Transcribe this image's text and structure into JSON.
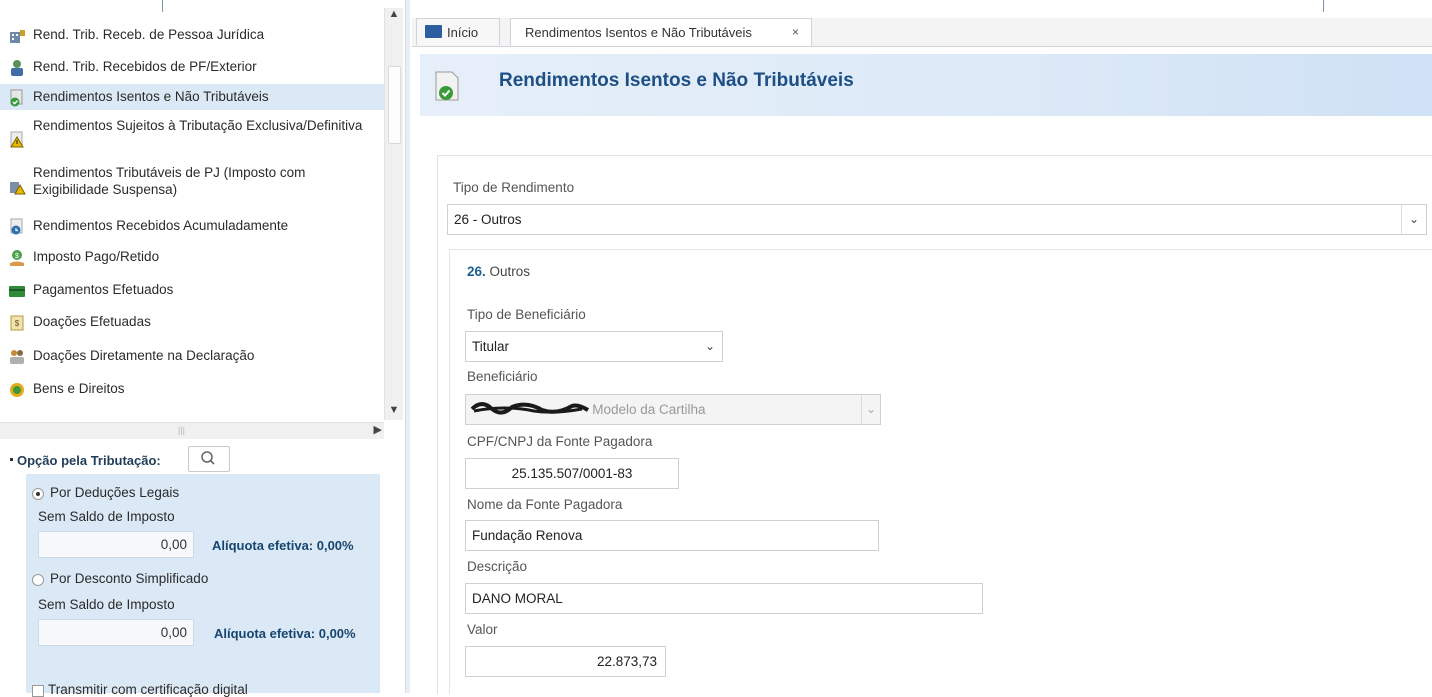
{
  "nav": {
    "items": [
      {
        "label": "Rend. Trib. Receb. de Pessoa Jurídica",
        "icon": "building-tax-icon"
      },
      {
        "label": "Rend. Trib. Recebidos de PF/Exterior",
        "icon": "person-money-icon"
      },
      {
        "label": "Rendimentos Isentos e Não Tributáveis",
        "icon": "document-check-icon",
        "selected": true
      },
      {
        "label": "Rendimentos Sujeitos à Tributação Exclusiva/Definitiva",
        "icon": "warning-document-icon"
      },
      {
        "label": "Rendimentos Tributáveis de PJ (Imposto com Exigibilidade Suspensa)",
        "icon": "building-warning-icon"
      },
      {
        "label": "Rendimentos Recebidos Acumuladamente",
        "icon": "document-clock-icon"
      },
      {
        "label": "Imposto Pago/Retido",
        "icon": "money-hand-icon"
      },
      {
        "label": "Pagamentos Efetuados",
        "icon": "card-icon"
      },
      {
        "label": "Doações Efetuadas",
        "icon": "donation-note-icon"
      },
      {
        "label": "Doações Diretamente na Declaração",
        "icon": "people-donation-icon"
      },
      {
        "label": "Bens e Direitos",
        "icon": "assets-icon"
      }
    ]
  },
  "tributacao": {
    "title": "Opção pela Tributação:",
    "deducoes": {
      "label": "Por Deduções Legais",
      "saldo": "Sem Saldo de Imposto",
      "valor": "0,00",
      "aliquota": "Alíquota efetiva: 0,00%",
      "selected": true
    },
    "simplificado": {
      "label": "Por Desconto Simplificado",
      "saldo": "Sem Saldo de Imposto",
      "valor": "0,00",
      "aliquota": "Alíquota efetiva: 0,00%",
      "selected": false
    },
    "certificacao": "Transmitir com certificação digital"
  },
  "tabs": {
    "home": "Início",
    "current": "Rendimentos Isentos e Não Tributáveis",
    "close": "×"
  },
  "page": {
    "title": "Rendimentos Isentos e Não Tributáveis"
  },
  "form": {
    "tipo_rendimento_label": "Tipo de Rendimento",
    "tipo_rendimento_value": "26 - Outros",
    "section_num": "26.",
    "section_name": "Outros",
    "tipo_beneficiario_label": "Tipo de Beneficiário",
    "tipo_beneficiario_value": "Titular",
    "beneficiario_label": "Beneficiário",
    "beneficiario_value": "- Modelo da Cartilha",
    "cpf_label": "CPF/CNPJ da Fonte Pagadora",
    "cpf_value": "25.135.507/0001-83",
    "nome_label": "Nome da Fonte Pagadora",
    "nome_value": "Fundação Renova",
    "descricao_label": "Descrição",
    "descricao_value": "DANO MORAL",
    "valor_label": "Valor",
    "valor_value": "22.873,73"
  }
}
